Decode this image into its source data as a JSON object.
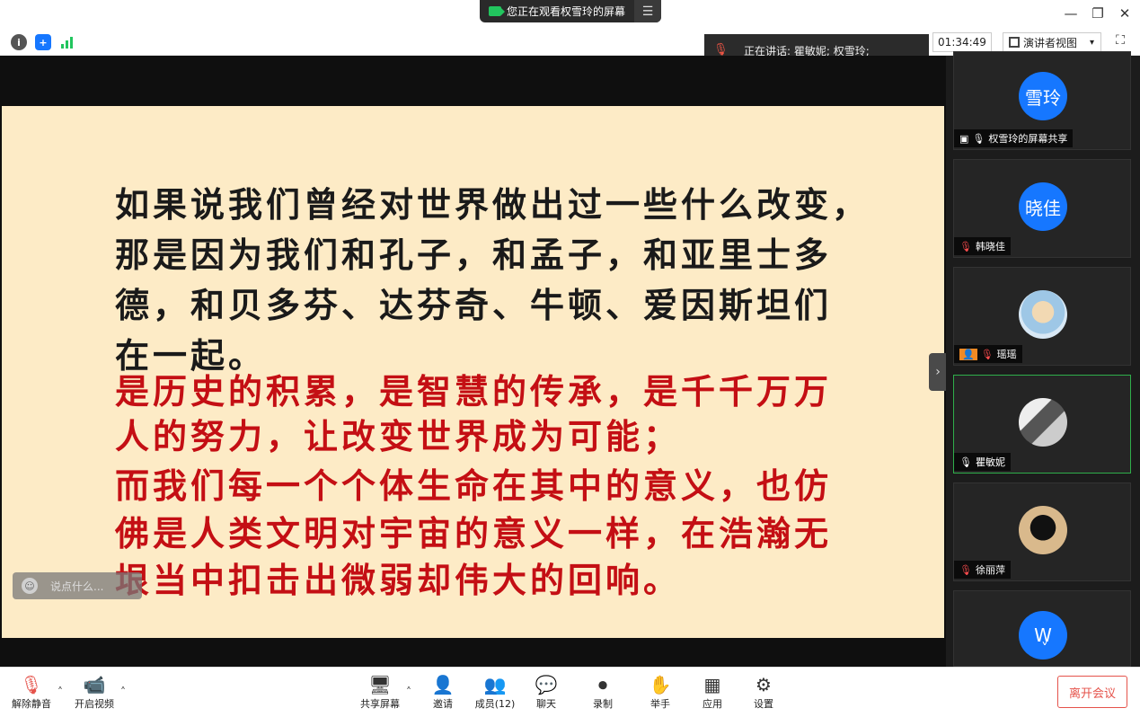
{
  "titlebar": {
    "banner_text": "您正在观看权雪玲的屏幕",
    "menu_icon": "menu-icon",
    "minimize": "—",
    "restore": "❐",
    "close": "✕"
  },
  "status": {
    "speaking_text": "正在讲话: 瞿敏妮; 权雪玲;",
    "timer": "01:34:49",
    "view_label": "演讲者视图",
    "view_caret": "▾",
    "info_icon": "info-icon",
    "shield_icon": "shield-icon",
    "signal_icon": "signal-icon",
    "fullscreen_icon": "fullscreen-icon"
  },
  "slide": {
    "black_lines": [
      "如果说我们曾经对世界做出过一些什么改变，",
      "那是因为我们和孔子，和孟子，和亚里士多",
      "德，和贝多芬、达芬奇、牛顿、爱因斯坦们",
      "在一起。"
    ],
    "red_lines": [
      "是历史的积累，是智慧的传承，是千千万万",
      "人的努力，让改变世界成为可能；",
      "而我们每一个个体生命在其中的意义，也仿",
      "佛是人类文明对宇宙的意义一样，在浩瀚无",
      "垠当中扣击出微弱却伟大的回响。"
    ],
    "colors": {
      "background": "#fdebc6",
      "black_text": "#1a1a1a",
      "red_text": "#c40f14"
    }
  },
  "chat": {
    "placeholder": "说点什么..."
  },
  "participants": [
    {
      "avatar_text": "雪玲",
      "name": "权雪玲的屏幕共享",
      "muted": false,
      "sharing": true
    },
    {
      "avatar_text": "晓佳",
      "name": "韩晓佳",
      "muted": true
    },
    {
      "avatar_text": "",
      "name": "瑶瑶",
      "muted": true,
      "host": true
    },
    {
      "avatar_text": "",
      "name": "瞿敏妮",
      "muted": false,
      "active": true
    },
    {
      "avatar_text": "",
      "name": "徐丽萍",
      "muted": true
    },
    {
      "avatar_text": "W",
      "name": "",
      "muted": false
    }
  ],
  "bottombar": {
    "unmute": "解除静音",
    "start_video": "开启视频",
    "share": "共享屏幕",
    "invite": "邀请",
    "members": "成员(12)",
    "chat": "聊天",
    "record": "录制",
    "raise_hand": "举手",
    "apps": "应用",
    "settings": "设置",
    "leave": "离开会议"
  }
}
